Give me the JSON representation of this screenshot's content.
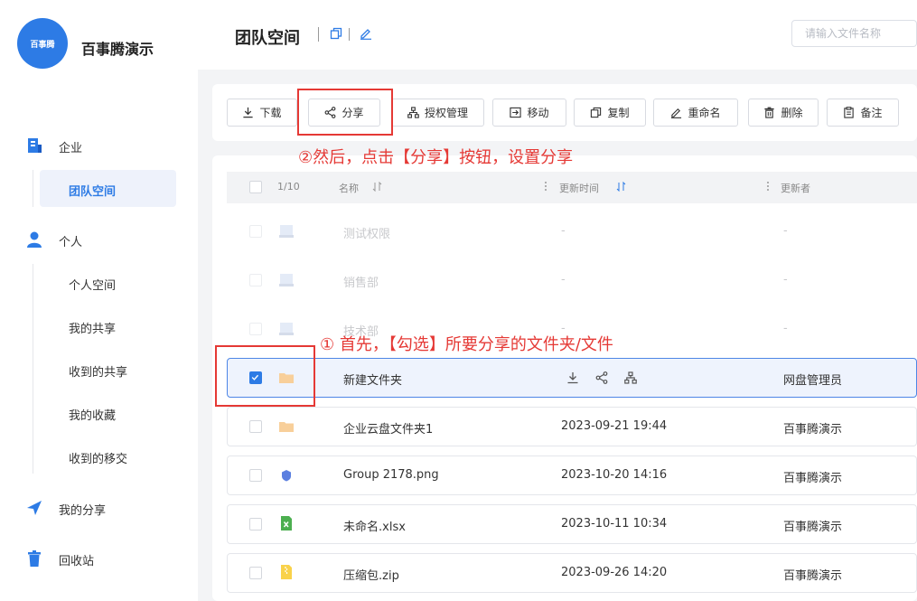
{
  "app": {
    "brand_name": "百事腾演示",
    "logo_text": "百事腾"
  },
  "sidebar": {
    "enterprise": "企业",
    "team_space": "团队空间",
    "personal": "个人",
    "personal_items": [
      "个人空间",
      "我的共享",
      "收到的共享",
      "我的收藏",
      "收到的移交"
    ],
    "my_share": "我的分享",
    "recycle_bin": "回收站"
  },
  "header": {
    "title": "团队空间",
    "search_placeholder": "请输入文件名称"
  },
  "toolbar": {
    "download": "下载",
    "share": "分享",
    "permission": "授权管理",
    "move": "移动",
    "copy": "复制",
    "rename": "重命名",
    "delete": "删除",
    "note": "备注"
  },
  "table": {
    "count": "1/10",
    "col_name": "名称",
    "col_time": "更新时间",
    "col_updater": "更新者",
    "rows": [
      {
        "name": "测试权限",
        "time": "-",
        "updater": "-",
        "icon": "folder-drive-icon"
      },
      {
        "name": "销售部",
        "time": "-",
        "updater": "-",
        "icon": "folder-drive-icon"
      },
      {
        "name": "技术部",
        "time": "-",
        "updater": "-",
        "icon": "folder-drive-icon"
      },
      {
        "name": "新建文件夹",
        "time": "",
        "updater": "网盘管理员",
        "icon": "folder-icon",
        "selected": true
      },
      {
        "name": "企业云盘文件夹1",
        "time": "2023-09-21 19:44",
        "updater": "百事腾演示",
        "icon": "folder-icon"
      },
      {
        "name": "Group 2178.png",
        "time": "2023-10-20 14:16",
        "updater": "百事腾演示",
        "icon": "image-file-icon"
      },
      {
        "name": "未命名.xlsx",
        "time": "2023-10-11 10:34",
        "updater": "百事腾演示",
        "icon": "excel-file-icon"
      },
      {
        "name": "压缩包.zip",
        "time": "2023-09-26 14:20",
        "updater": "百事腾演示",
        "icon": "zip-file-icon"
      }
    ]
  },
  "annotations": {
    "step1": "① 首先，【勾选】所要分享的文件夹/文件",
    "step2": "②然后，点击【分享】按钮，设置分享"
  },
  "colors": {
    "accent": "#2d7be5",
    "annotation": "#e53935",
    "selected_bg": "#eef3fd"
  }
}
